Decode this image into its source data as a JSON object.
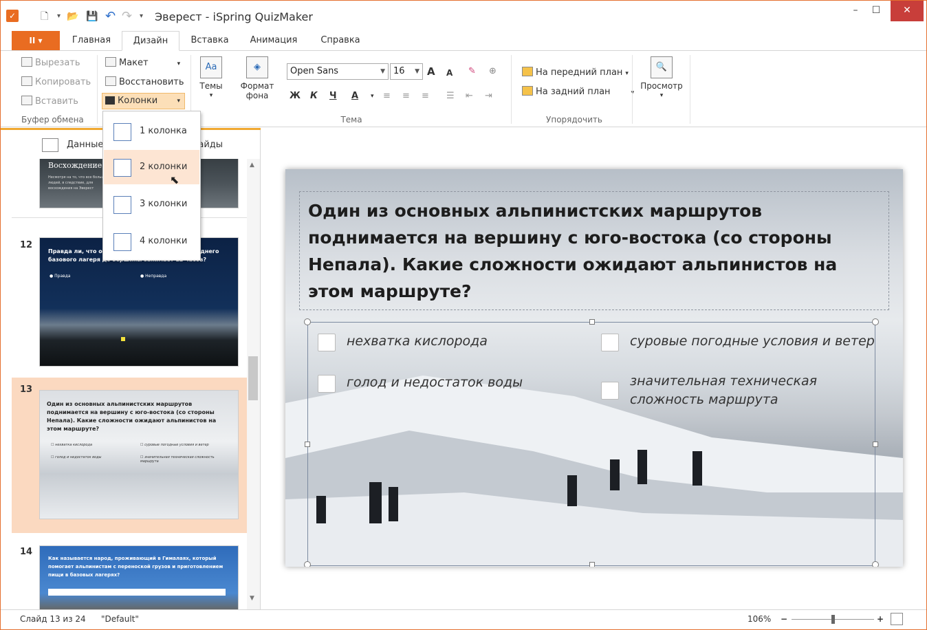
{
  "window": {
    "title": "Эверест - iSpring QuizMaker",
    "minimize": "–",
    "maximize": "☐",
    "close": "✕"
  },
  "quick_access": {
    "new": "🗋",
    "open": "📂",
    "save": "💾",
    "undo": "↶",
    "redo": "↷",
    "more": "▾"
  },
  "tabs": {
    "file": "II ▾",
    "items": [
      "Главная",
      "Дизайн",
      "Вставка",
      "Анимация",
      "Справка"
    ],
    "active": "Дизайн"
  },
  "ribbon": {
    "clipboard": {
      "cut": "Вырезать",
      "copy": "Копировать",
      "paste": "Вставить",
      "label": "Буфер обмена"
    },
    "layout": {
      "maket": "Макет",
      "reset": "Восстановить",
      "columns": "Колонки"
    },
    "themes": {
      "label_btn": "Темы",
      "icon_text": "Aa"
    },
    "background": {
      "line1": "Формат",
      "line2": "фона"
    },
    "font": {
      "family": "Open Sans",
      "size": "16",
      "bold": "Ж",
      "italic": "К",
      "underline": "Ч",
      "color": "А",
      "grow": "A",
      "shrink": "A"
    },
    "theme_group": "Тема",
    "arrange": {
      "front": "На передний план",
      "back": "На задний план",
      "label": "Упорядочить"
    },
    "preview": "Просмотр"
  },
  "columns_menu": {
    "items": [
      "1 колонка",
      "2 колонки",
      "3 колонки",
      "4 колонки"
    ],
    "hovered": "2 колонки"
  },
  "panel": {
    "tab_data": "Данные",
    "tab_slides": "Слайды",
    "slides": [
      {
        "number": "",
        "title": "Восхождение на",
        "text": "Несмотря на то, что все больше людей, в следствие, для восхождения на Эверест"
      },
      {
        "number": "12",
        "title": "Правда ли, что обычное восхождение от последнего базового лагеря до вершины занимает 12 часов?",
        "options": [
          "Правда",
          "Неправда"
        ]
      },
      {
        "number": "13",
        "title": "Один из основных альпинистских маршрутов поднимается на вершину с юго-востока (со стороны Непала). Какие сложности ожидают альпинистов на этом маршруте?",
        "options": [
          "нехватка кислорода",
          "суровые погодные условия и ветер",
          "голод и недостаток воды",
          "значительная техническая сложность маршрута"
        ]
      },
      {
        "number": "14",
        "title": "Как называется народ, проживающий в Гималаях, который помогает альпинистам с переноской грузов и приготовлением пищи в базовых лагерях?"
      }
    ]
  },
  "slide": {
    "question": "Один из основных альпинистских маршрутов поднимается на вершину с юго-востока (со стороны Непала). Какие сложности ожидают альпинистов на этом маршруте?",
    "answers": [
      "нехватка кислорода",
      "суровые погодные условия и ветер",
      "голод и недостаток воды",
      "значительная техническая сложность маршрута"
    ]
  },
  "status": {
    "slide_info": "Слайд 13 из 24",
    "theme": "\"Default\"",
    "zoom": "106%",
    "zoom_fraction": 0.5
  },
  "colors": {
    "accent": "#e96c21",
    "selection": "#fbd9c0",
    "hover": "#fde5d3"
  }
}
